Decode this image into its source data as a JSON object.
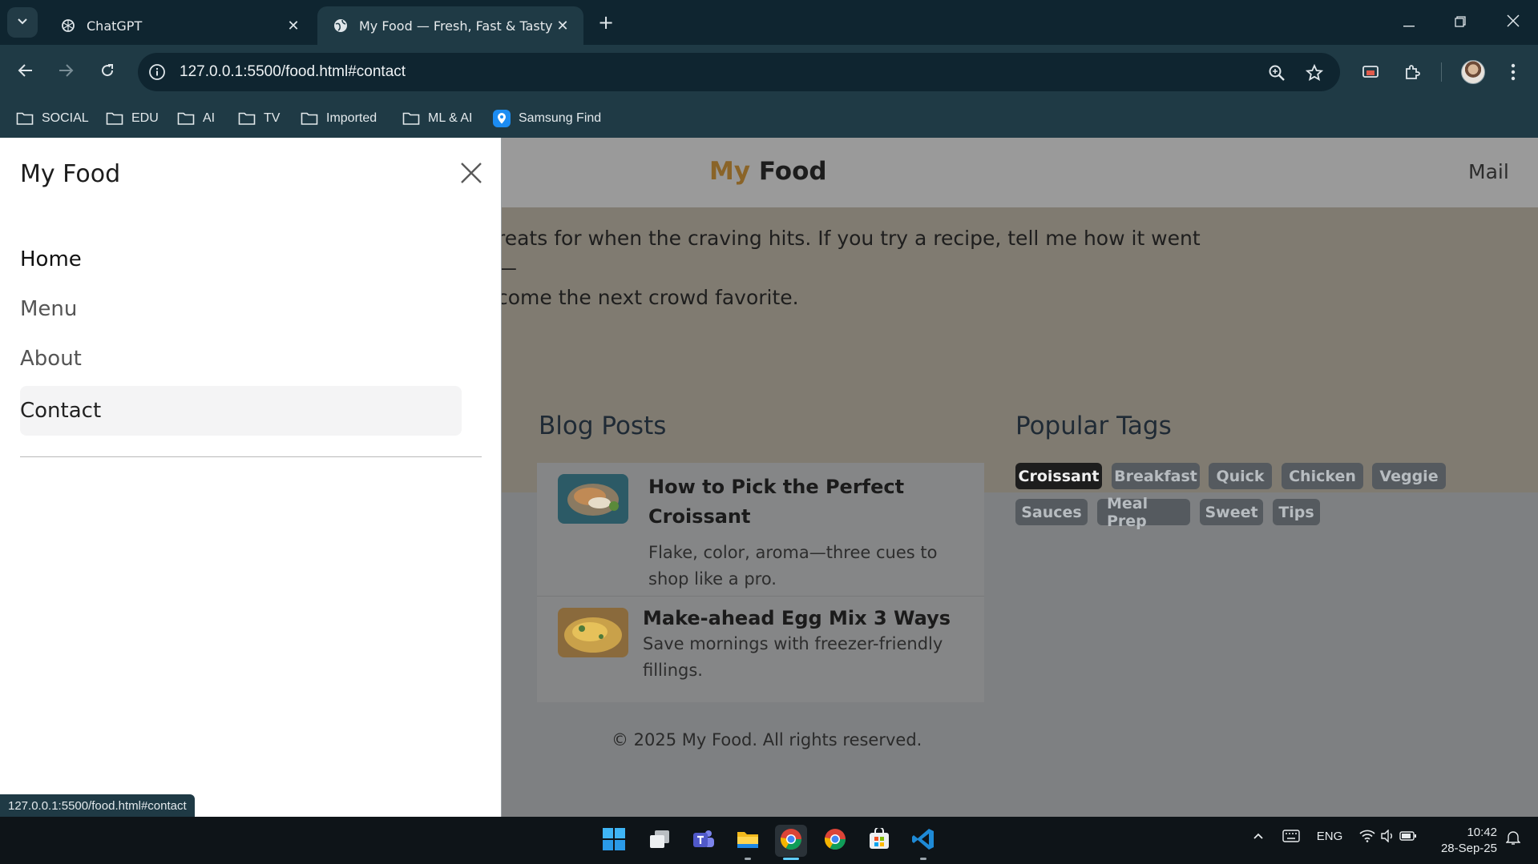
{
  "browser": {
    "tabs": [
      {
        "title": "ChatGPT",
        "icon": "chatgpt-icon",
        "active": false
      },
      {
        "title": "My Food — Fresh, Fast & Tasty",
        "icon": "globe-icon",
        "active": true
      }
    ],
    "url": "127.0.0.1:5500/food.html#contact",
    "bookmarks": [
      {
        "label": "SOCIAL",
        "icon": "folder-icon"
      },
      {
        "label": "EDU",
        "icon": "folder-icon"
      },
      {
        "label": "AI",
        "icon": "folder-icon"
      },
      {
        "label": "TV",
        "icon": "folder-icon"
      },
      {
        "label": "Imported",
        "icon": "folder-icon"
      },
      {
        "label": "ML & AI",
        "icon": "folder-icon"
      },
      {
        "label": "Samsung Find",
        "icon": "location-pin-icon"
      }
    ],
    "status_url": "127.0.0.1:5500/food.html#contact"
  },
  "site": {
    "brand_my": "My",
    "brand_food": "Food",
    "nav_mail": "Mail",
    "hero_line1": "reats for when the craving hits. If you try a recipe, tell me how it went—",
    "hero_line2": "come the next crowd favorite.",
    "blog_title": "Blog Posts",
    "posts": [
      {
        "title_line1": "How to Pick the Perfect",
        "title_line2": "Croissant",
        "excerpt_line1": "Flake, color, aroma—three cues to",
        "excerpt_line2": "shop like a pro."
      },
      {
        "title_line1": "Make-ahead Egg Mix 3 Ways",
        "excerpt_line1": "Save mornings with freezer-friendly",
        "excerpt_line2": "fillings."
      }
    ],
    "tags_title": "Popular Tags",
    "tags": [
      "Croissant",
      "Breakfast",
      "Quick",
      "Chicken",
      "Veggie",
      "Sauces",
      "Meal Prep",
      "Sweet",
      "Tips"
    ],
    "active_tag": "Croissant",
    "footer": "© 2025 My Food. All rights reserved."
  },
  "drawer": {
    "title": "My Food",
    "items": [
      "Home",
      "Menu",
      "About",
      "Contact"
    ],
    "selected": "Contact"
  },
  "taskbar": {
    "language": "ENG",
    "time": "10:42",
    "date": "28-Sep-25"
  },
  "colors": {
    "chrome_dark": "#0f2530",
    "chrome_toolbar": "#1f3a45",
    "brand_accent": "#8a6428",
    "overlay_page": "#7e8082",
    "active_tag_bg": "#1d1d1d"
  }
}
